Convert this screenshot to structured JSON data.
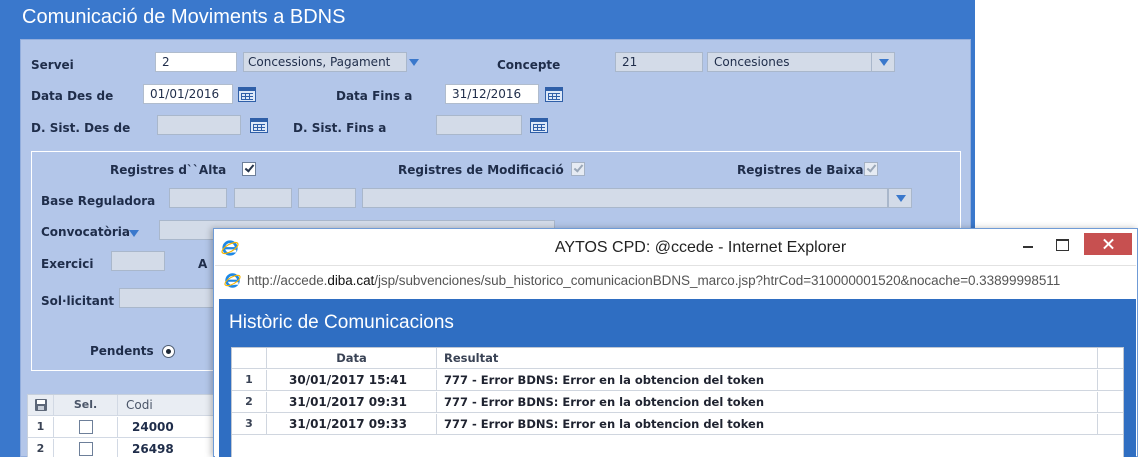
{
  "app": {
    "title": "Comunicació de Moviments a BDNS"
  },
  "filters": {
    "servei_label": "Servei",
    "servei_code": "2",
    "servei_name": "Concessions, Pagament",
    "concepte_label": "Concepte",
    "concepte_code": "21",
    "concepte_name": "Concesiones",
    "data_des_label": "Data Des de",
    "data_des_value": "01/01/2016",
    "data_fins_label": "Data Fins a",
    "data_fins_value": "31/12/2016",
    "dsist_des_label": "D. Sist. Des de",
    "dsist_des_value": "",
    "dsist_fins_label": "D. Sist. Fins a",
    "dsist_fins_value": ""
  },
  "options": {
    "alta_label": "Registres d``Alta",
    "alta_checked": true,
    "modificacio_label": "Registres de Modificació",
    "modificacio_checked": true,
    "baixa_label": "Registres de Baixa",
    "baixa_checked": true,
    "base_reguladora_label": "Base Reguladora",
    "convocatoria_label": "Convocatòria",
    "exercici_label": "Exercici",
    "exercici_extra_label": "A",
    "sollicitant_label": "Sol·licitant",
    "pendents_label": "Pendents",
    "pendents_selected": true
  },
  "grid": {
    "columns": [
      "Sel.",
      "Codi"
    ],
    "rows": [
      {
        "num": "1",
        "codi": "24000"
      },
      {
        "num": "2",
        "codi": "26498"
      }
    ]
  },
  "popup": {
    "window_title": "AYTOS CPD: @ccede - Internet Explorer",
    "url_prefix": "http://accede.",
    "url_domain": "diba.cat",
    "url_suffix": "/jsp/subvenciones/sub_historico_comunicacionBDNS_marco.jsp?htrCod=310000001520&nocache=0.33899998511",
    "section_title": "Històric de Comunicacions",
    "columns": {
      "data": "Data",
      "resultat": "Resultat"
    },
    "rows": [
      {
        "num": "1",
        "data": "30/01/2017 15:41",
        "resultat": "777 - Error BDNS: Error en la obtencion del token"
      },
      {
        "num": "2",
        "data": "31/01/2017 09:31",
        "resultat": "777 - Error BDNS: Error en la obtencion del token"
      },
      {
        "num": "3",
        "data": "31/01/2017 09:33",
        "resultat": "777 - Error BDNS: Error en la obtencion del token"
      }
    ]
  },
  "colors": {
    "app_background": "#3a78cc",
    "form_background": "#b3c6e9",
    "popup_content": "#2f6ec2",
    "close_button": "#c75050"
  },
  "icons": [
    "calendar-icon",
    "dropdown-arrow-icon",
    "checkbox-icon",
    "radio-icon",
    "save-icon",
    "ie-logo-icon",
    "minimize-icon",
    "maximize-icon",
    "close-icon"
  ]
}
